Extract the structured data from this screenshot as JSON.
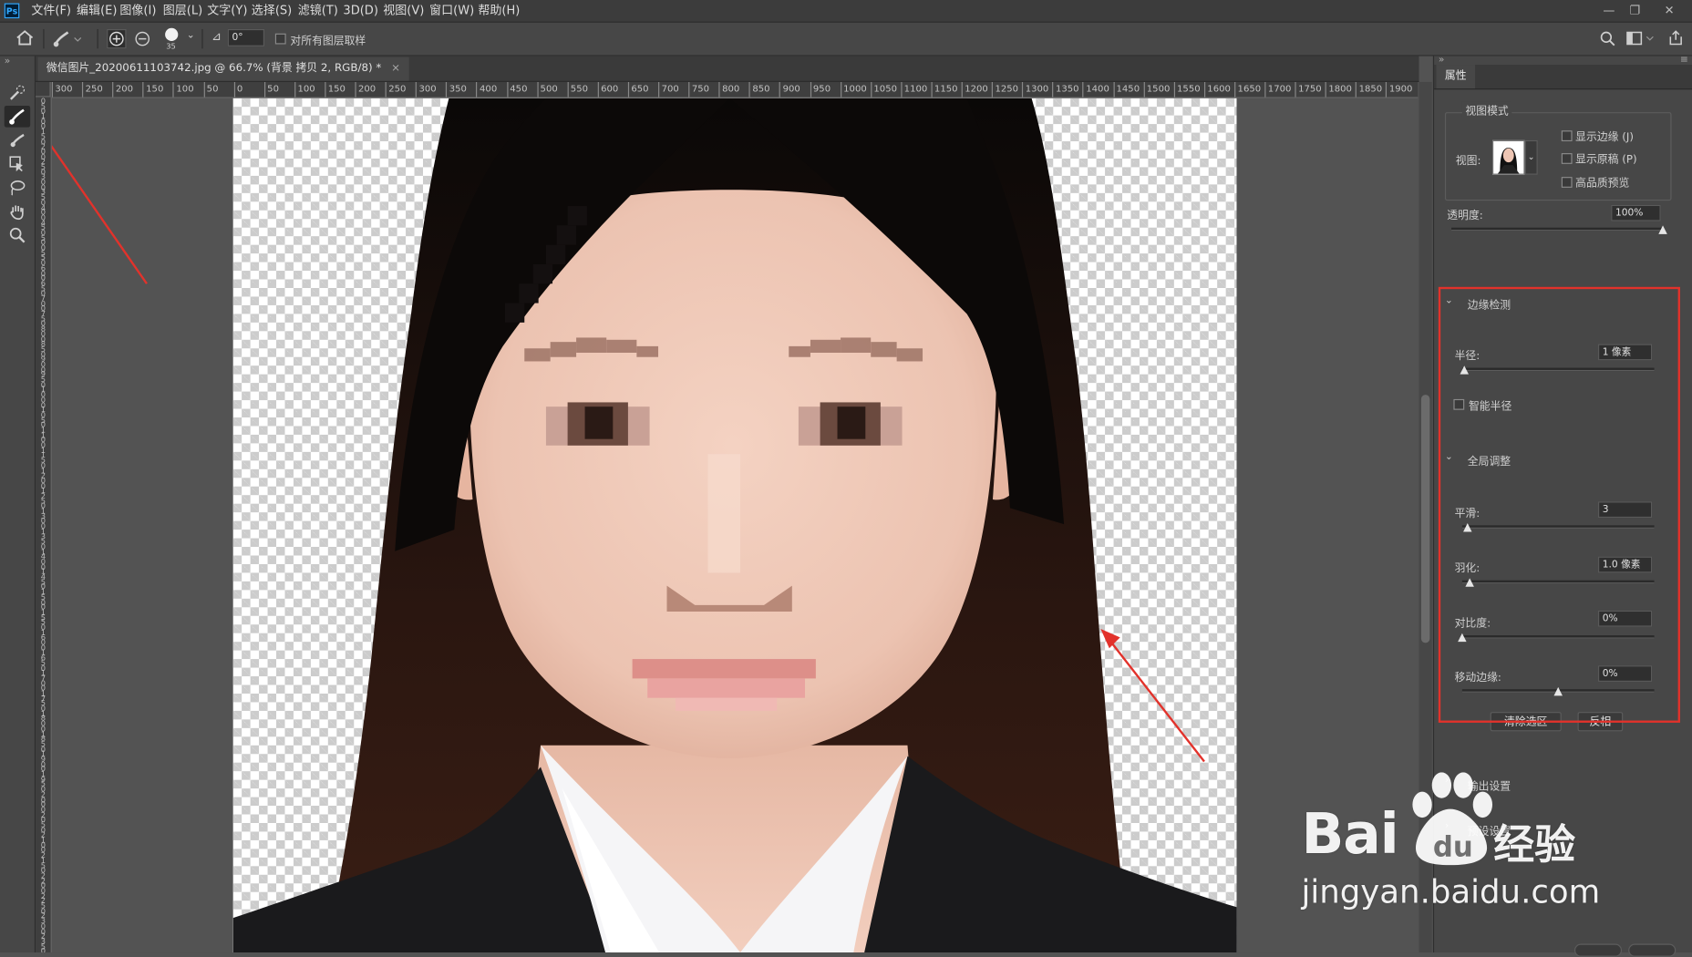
{
  "menubar": {
    "logo": "Ps",
    "items": [
      "文件(F)",
      "编辑(E)",
      "图像(I)",
      "图层(L)",
      "文字(Y)",
      "选择(S)",
      "滤镜(T)",
      "3D(D)",
      "视图(V)",
      "窗口(W)",
      "帮助(H)"
    ],
    "window_controls": [
      "—",
      "❐",
      "✕"
    ]
  },
  "optionsbar": {
    "brush_size": "35",
    "angle_icon": "⊿",
    "angle_value": "0°",
    "sample_all_layers": "对所有图层取样"
  },
  "document": {
    "tab_title": "微信图片_20200611103742.jpg @ 66.7% (背景 拷贝 2, RGB/8) *",
    "tab_close": "×"
  },
  "rulers": {
    "horizontal": [
      "300",
      "250",
      "200",
      "150",
      "100",
      "50",
      "0",
      "50",
      "100",
      "150",
      "200",
      "250",
      "300",
      "350",
      "400",
      "450",
      "500",
      "550",
      "600",
      "650",
      "700",
      "750",
      "800",
      "850",
      "900",
      "950",
      "1000",
      "1050",
      "1100",
      "1150",
      "1200",
      "1250",
      "1300",
      "1350",
      "1400",
      "1450",
      "1500",
      "1550",
      "1600",
      "1650",
      "1700",
      "1750",
      "1800",
      "1850",
      "1900"
    ],
    "vertical": [
      "0",
      "5",
      "0",
      "1",
      "0",
      "0",
      "1",
      "5",
      "0",
      "2",
      "0",
      "0",
      "2",
      "5",
      "0",
      "3",
      "0",
      "0",
      "3",
      "5",
      "0",
      "4",
      "0",
      "0",
      "4",
      "5",
      "0",
      "5",
      "0",
      "0",
      "5",
      "5",
      "0",
      "6",
      "0",
      "0",
      "6",
      "5",
      "0",
      "7",
      "0",
      "0",
      "7",
      "5",
      "0",
      "8",
      "0",
      "0",
      "8",
      "5",
      "0",
      "9",
      "0",
      "0",
      "9",
      "5",
      "0",
      "1",
      "0",
      "0",
      "0",
      "1",
      "0",
      "5",
      "0",
      "1",
      "1",
      "0",
      "0",
      "1",
      "1",
      "5",
      "0",
      "1",
      "2",
      "0",
      "0",
      "1",
      "2",
      "5",
      "0",
      "1",
      "3",
      "0",
      "0",
      "1",
      "3",
      "5",
      "0",
      "1",
      "4",
      "0",
      "0",
      "1",
      "4",
      "5",
      "0",
      "1",
      "5",
      "0",
      "0",
      "1",
      "5",
      "5",
      "0",
      "1",
      "6",
      "0",
      "0",
      "1",
      "6",
      "5",
      "0",
      "1",
      "7",
      "0",
      "0",
      "1",
      "7",
      "5",
      "0",
      "1",
      "8",
      "0",
      "0",
      "1",
      "8",
      "5",
      "0",
      "1",
      "9",
      "0",
      "0",
      "1",
      "9",
      "5",
      "0",
      "2",
      "0",
      "0",
      "0",
      "2",
      "0",
      "5",
      "0",
      "2",
      "1",
      "0",
      "0",
      "2",
      "1",
      "5",
      "0",
      "2",
      "2",
      "0",
      "0",
      "2",
      "2",
      "5",
      "0",
      "2",
      "3",
      "0",
      "0",
      "2",
      "3",
      "5",
      "0"
    ]
  },
  "properties": {
    "tab": "属性",
    "view_mode": {
      "title": "视图模式",
      "view_label": "视图:",
      "show_edge": "显示边缘 (J)",
      "show_original": "显示原稿 (P)",
      "hq_preview": "高品质预览"
    },
    "opacity": {
      "label": "透明度:",
      "value": "100%",
      "level": 1.0
    },
    "edge_detection": {
      "title": "边缘检测",
      "radius_label": "半径:",
      "radius_value": "1 像素",
      "radius_level": 0.01,
      "smart_radius": "智能半径"
    },
    "global": {
      "title": "全局调整",
      "smooth_label": "平滑:",
      "smooth_value": "3",
      "smooth_level": 0.03,
      "feather_label": "羽化:",
      "feather_value": "1.0 像素",
      "feather_level": 0.04,
      "contrast_label": "对比度:",
      "contrast_value": "0%",
      "contrast_level": 0.0,
      "shift_label": "移动边缘:",
      "shift_value": "0%",
      "shift_level": 0.5
    },
    "buttons": {
      "clear": "清除选区",
      "invert": "反相"
    },
    "output_settings": "输出设置",
    "preset_settings": "预设设置"
  },
  "watermark": {
    "brand": "Bai",
    "suffix": "经验",
    "url": "jingyan.baidu.com"
  },
  "colors": {
    "annotation_red": "#e2322b",
    "ps_blue": "#31a8ff"
  }
}
